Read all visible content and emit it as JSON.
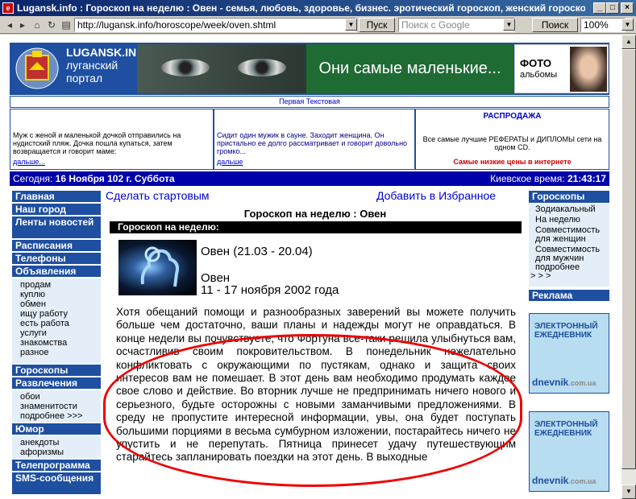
{
  "window": {
    "title": "Lugansk.info : Гороскоп на неделю : Овен - семья, любовь, здоровье, бизнес. эротический гороскоп, женский гороскоп,..."
  },
  "toolbar": {
    "url": "http://lugansk.info/horoscope/week/oven.shtml",
    "go": "Пуск",
    "search_placeholder": "Поиск с Google",
    "search": "Поиск",
    "zoom": "100%"
  },
  "header": {
    "brand": "LUGANSK.INFO",
    "brand_sub1": "луганский",
    "brand_sub2": "портал",
    "banner_text": "Они самые маленькие...",
    "photo1": "ФОТО",
    "photo2": "альбомы"
  },
  "top_link": "Первая Текстовая",
  "ads": [
    {
      "text": "Муж с женой и маленькой дочкой отправились на нудистский пляж. Дочка пошла купаться, затем возвращается и говорит маме:",
      "more": "дальше..."
    },
    {
      "text": "Сидит один мужик в сауне. Заходит женщина. Он пристально ее долго рассматривает и говорит довольно громко...",
      "more": "дальше"
    },
    {
      "title": "РАСПРОДАЖА",
      "text": "Все самые лучшие РЕФЕРАТЫ и ДИПЛОМЫ сети на одном CD.",
      "note": "Самые низкие цены в интернете"
    }
  ],
  "datebar": {
    "left_label": "Сегодня:",
    "left_value": "16 Ноября 102 г. Суббота",
    "right_label": "Киевское время:",
    "right_value": "21:43:17"
  },
  "left_nav": {
    "main": "Главная",
    "city": "Наш город",
    "news": "Ленты новостей",
    "schedule": "Расписания",
    "phones": "Телефоны",
    "ads": "Объявления",
    "ads_items": [
      "продам",
      "куплю",
      "обмен",
      "ищу работу",
      "есть работа",
      "услуги",
      "знакомства",
      "разное"
    ],
    "horoscopes": "Гороскопы",
    "fun": "Развлечения",
    "fun_items": [
      "обои",
      "знаменитости",
      "подробнее >>>"
    ],
    "humor": "Юмор",
    "humor_items": [
      "анекдоты",
      "афоризмы"
    ],
    "tv": "Телепрограмма",
    "sms": "SMS-сообщения"
  },
  "main": {
    "make_start": "Сделать стартовым",
    "add_fav": "Добавить в Избранное",
    "heading": "Гороскоп на неделю : Овен",
    "section": "Гороскоп на неделю:",
    "sign_title": "Овен (21.03 - 20.04)",
    "sign_name": "Овен",
    "dates": "11 - 17 ноября 2002 года",
    "text": "Хотя обещаний помощи и разнообразных заверений вы можете получить больше чем достаточно, ваши планы и надежды могут не оправдаться. В конце недели вы почувствуете, что Фортуна все-таки решила улыбнуться вам, осчастливив своим покровительством. В понедельник нежелательно конфликтовать с окружающими по пустякам, однако и защита своих интересов вам не помешает. В этот день вам необходимо продумать каждое свое слово и действие. Во вторник лучше не предпринимать ничего нового и серьезного, будьте осторожны с новыми заманчивыми предложениями. В среду не пропустите интересной информации, увы, она будет поступать большими порциями в весьма сумбурном изложении, постарайтесь ничего не упустить и не перепутать. Пятница принесет удачу путешествующим старайтесь запланировать поездки на этот день. В выходные"
  },
  "right_nav": {
    "horoscopes": "Гороскопы",
    "items": [
      "Зодиакальный",
      "На неделю",
      "Совместимость для женщин",
      "Совместимость для мужчин",
      "подробнее",
      "> > >"
    ],
    "ads": "Реклама",
    "adbox1": "ЭЛЕКТРОННЫЙ ЕЖЕДНЕВНИК",
    "adbox_domain": "dnevnik",
    ".ua": ".com.ua"
  }
}
